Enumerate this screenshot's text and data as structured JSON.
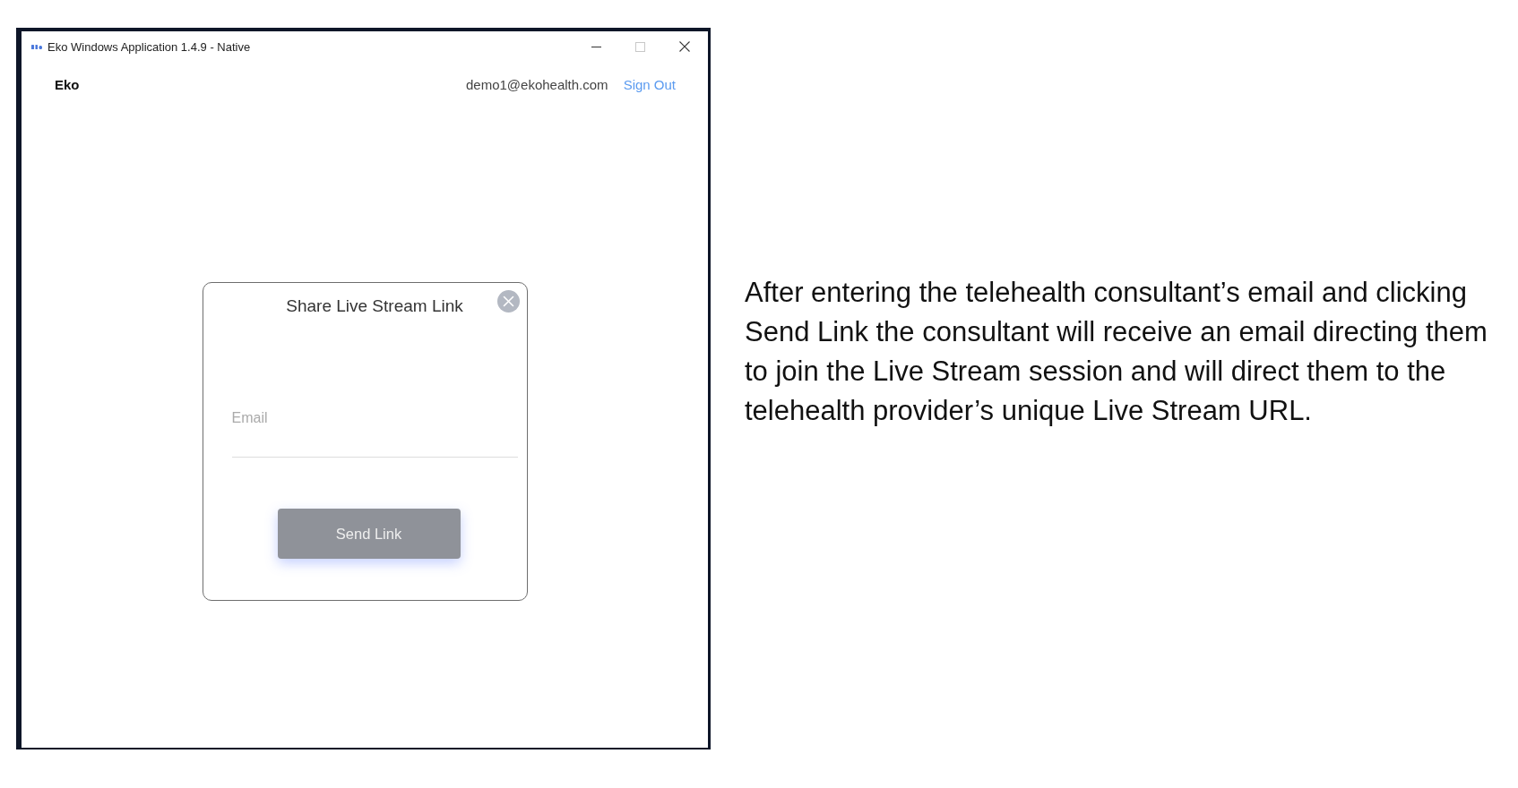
{
  "window": {
    "title": "Eko Windows Application 1.4.9 - Native",
    "controls": [
      {
        "kind": "minimize",
        "disabled": false
      },
      {
        "kind": "maximize",
        "disabled": true
      },
      {
        "kind": "close",
        "disabled": false
      }
    ]
  },
  "header": {
    "brand": "Eko",
    "user_email": "demo1@ekohealth.com",
    "sign_out": "Sign Out"
  },
  "dialog": {
    "title": "Share Live Stream Link",
    "email_field": {
      "placeholder": "Email"
    },
    "send_button": {
      "label": "Send Link",
      "disabled": true
    }
  },
  "caption": "After entering the telehealth consultant’s email and clicking Send Link the consultant will receive an email directing them to join the Live Stream session and will direct them to the telehealth provider’s unique Live Stream URL."
}
